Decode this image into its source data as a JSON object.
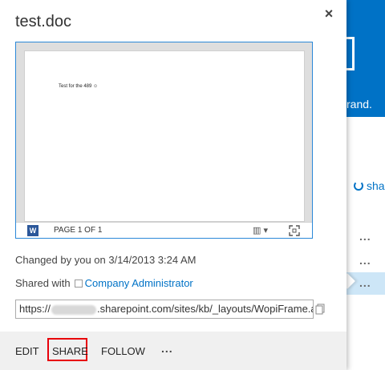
{
  "background": {
    "banner_text": "rand.",
    "share_link": "sha",
    "row_more": "..."
  },
  "callout": {
    "title": "test.doc",
    "close": "×",
    "preview": {
      "page_text": "Test for the 489 ☺",
      "app_icon": "W",
      "page_indicator": "PAGE 1 OF 1",
      "view_toggle": "▥ ▾"
    },
    "changed_by": "Changed by you on 3/14/2013 3:24 AM",
    "shared_with_label": "Shared with",
    "shared_with_name": "Company Administrator",
    "url_prefix": "https://",
    "url_suffix": ".sharepoint.com/sites/kb/_layouts/WopiFrame.aspx",
    "actions": {
      "edit": "EDIT",
      "share": "SHARE",
      "follow": "FOLLOW",
      "more": "..."
    }
  },
  "colors": {
    "accent": "#0072c6",
    "highlight_border": "#e8000a",
    "word_blue": "#2b579a"
  }
}
